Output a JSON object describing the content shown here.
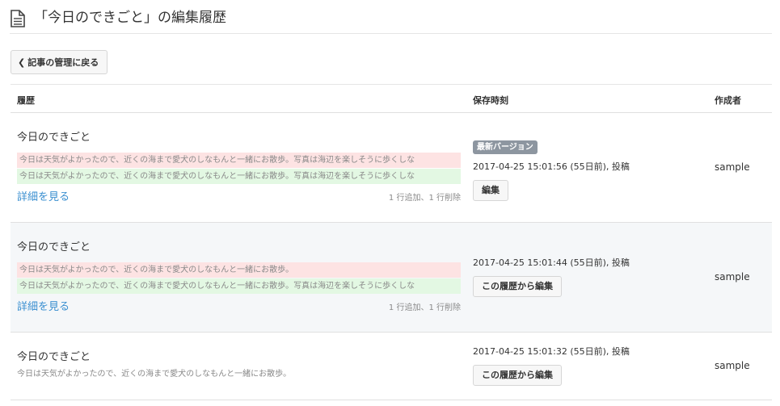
{
  "header": {
    "title": "「今日のできごと」の編集履歴",
    "icon": "document-icon"
  },
  "back_button": {
    "label": "記事の管理に戻る",
    "icon": "chevron-left-icon"
  },
  "table": {
    "columns": {
      "history": "履歴",
      "saved_time": "保存時刻",
      "author": "作成者"
    },
    "rows": [
      {
        "title": "今日のできごと",
        "diff_removed": "今日は天気がよかったので、近くの海まで愛犬のしなもんと一緒にお散歩。写真は海辺を楽しそうに歩くしな",
        "diff_added": "今日は天気がよかったので、近くの海まで愛犬のしなもんと一緒にお散歩。写真は海辺を楽しそうに歩くしな",
        "detail_link": "詳細を見る",
        "stats": "1 行追加、1 行削除",
        "badge": "最新バージョン",
        "timestamp": "2017-04-25 15:01:56 (55日前), 投稿",
        "action": "編集",
        "author": "sample"
      },
      {
        "title": "今日のできごと",
        "diff_removed": "今日は天気がよかったので、近くの海まで愛犬のしなもんと一緒にお散歩。",
        "diff_added": "今日は天気がよかったので、近くの海まで愛犬のしなもんと一緒にお散歩。写真は海辺を楽しそうに歩くしな",
        "detail_link": "詳細を見る",
        "stats": "1 行追加、1 行削除",
        "timestamp": "2017-04-25 15:01:44 (55日前), 投稿",
        "action": "この履歴から編集",
        "author": "sample"
      },
      {
        "title": "今日のできごと",
        "text": "今日は天気がよかったので、近くの海まで愛犬のしなもんと一緒にお散歩。",
        "timestamp": "2017-04-25 15:01:32 (55日前), 投稿",
        "action": "この履歴から編集",
        "author": "sample"
      }
    ]
  },
  "colors": {
    "link": "#3a8fd0",
    "removed_bg": "#fde3e3",
    "added_bg": "#e3f8e3",
    "badge_bg": "#8d96a0"
  }
}
